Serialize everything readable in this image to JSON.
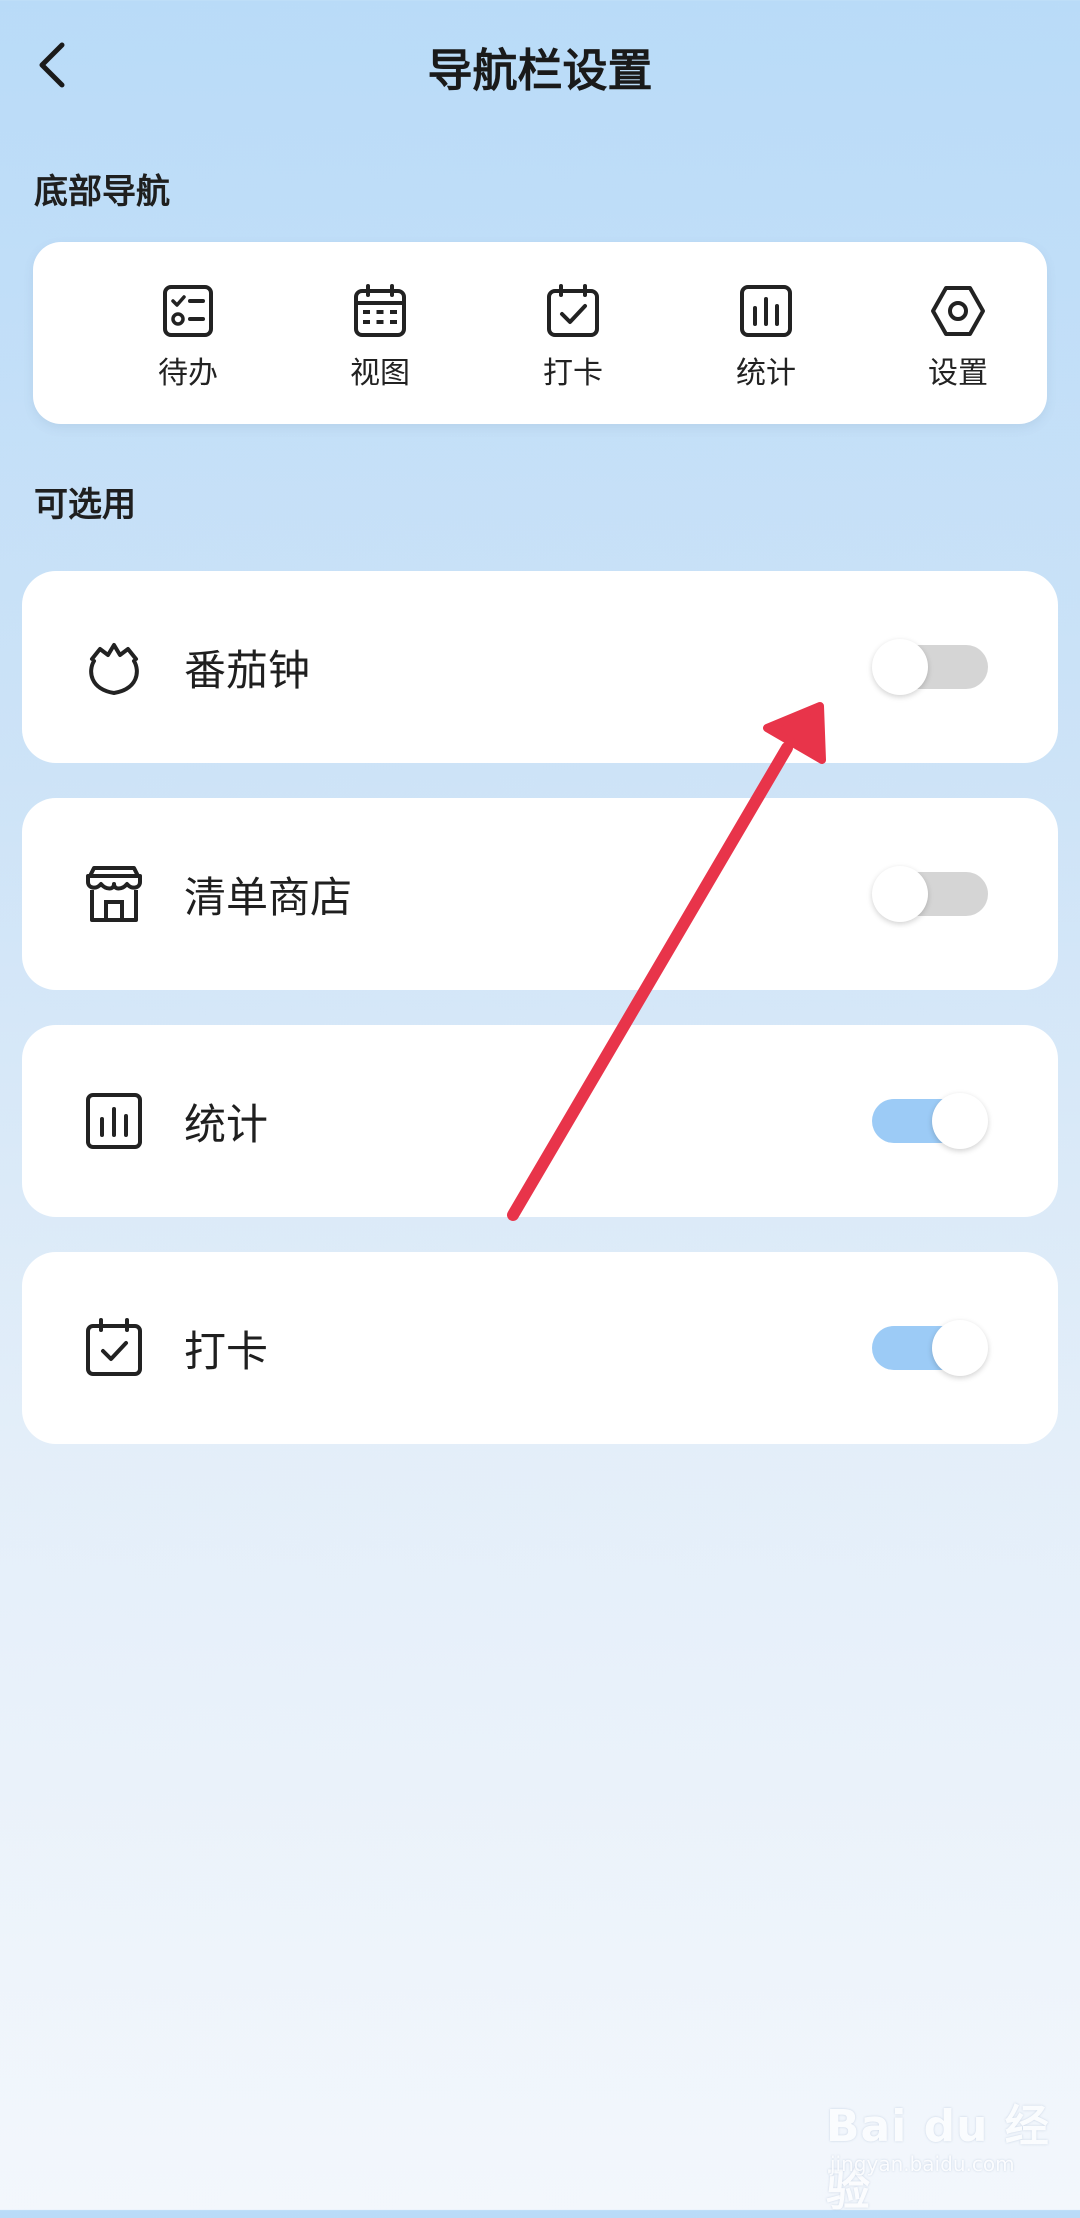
{
  "header": {
    "title": "导航栏设置",
    "back_icon": "chevron-left-icon"
  },
  "bottom_nav": {
    "section_label": "底部导航",
    "items": [
      {
        "label": "待办",
        "icon": "checklist-icon"
      },
      {
        "label": "视图",
        "icon": "calendar-grid-icon"
      },
      {
        "label": "打卡",
        "icon": "calendar-check-icon"
      },
      {
        "label": "统计",
        "icon": "bar-chart-icon"
      },
      {
        "label": "设置",
        "icon": "hexagon-settings-icon"
      }
    ]
  },
  "optional": {
    "section_label": "可选用",
    "items": [
      {
        "label": "番茄钟",
        "icon": "tomato-icon",
        "enabled": false
      },
      {
        "label": "清单商店",
        "icon": "store-icon",
        "enabled": false
      },
      {
        "label": "统计",
        "icon": "bar-chart-icon",
        "enabled": true
      },
      {
        "label": "打卡",
        "icon": "calendar-check-icon",
        "enabled": true
      }
    ]
  },
  "annotation": {
    "arrow_color": "#e8344a"
  },
  "watermark": {
    "main": "Bai du 经验",
    "sub": "jingyan.baidu.com"
  },
  "colors": {
    "toggle_on": "#9ccbf6",
    "toggle_off": "#d5d5d5",
    "accent_arrow": "#e8344a"
  }
}
